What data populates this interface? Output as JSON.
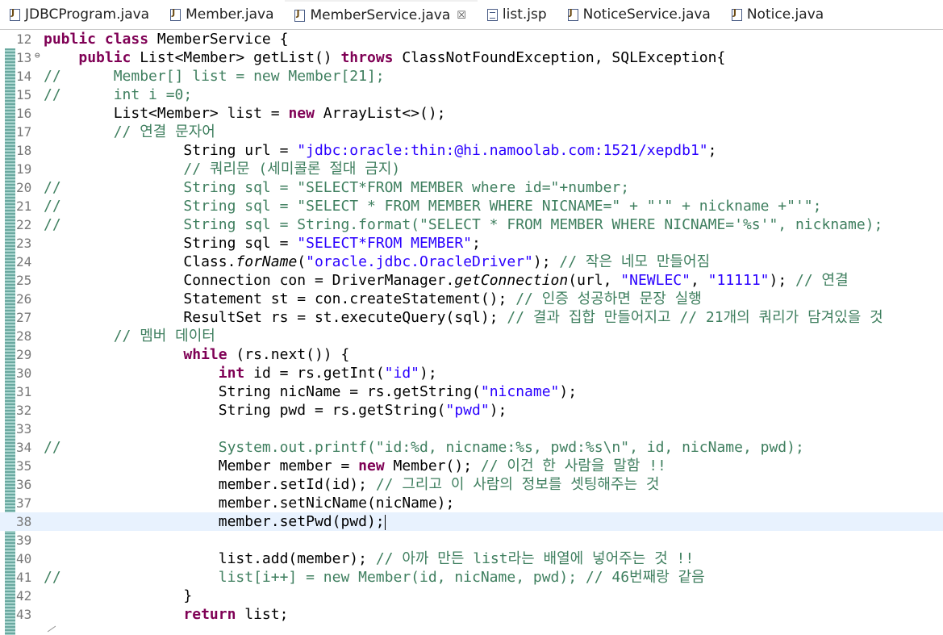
{
  "tabs": [
    {
      "label": "JDBCProgram.java",
      "icon": "java-file-icon",
      "active": false
    },
    {
      "label": "Member.java",
      "icon": "java-file-icon",
      "active": false
    },
    {
      "label": "MemberService.java",
      "icon": "java-file-icon",
      "active": true,
      "close": "☒"
    },
    {
      "label": "list.jsp",
      "icon": "jsp-file-icon",
      "active": false
    },
    {
      "label": "NoticeService.java",
      "icon": "java-file-icon",
      "active": false
    },
    {
      "label": "Notice.java",
      "icon": "java-file-icon",
      "active": false
    }
  ],
  "colors": {
    "keyword": "#7f0055",
    "string": "#2a00ff",
    "comment": "#3f7f5f",
    "line_number": "#787878",
    "current_line": "#e8f2fe"
  },
  "editor": {
    "current_line": 38,
    "lines": [
      {
        "n": "12",
        "segs": [
          [
            "kw",
            "public "
          ],
          [
            "kw",
            "class "
          ],
          [
            "",
            "MemberService {"
          ]
        ]
      },
      {
        "n": "13",
        "fold": "⊖",
        "segs": [
          [
            "",
            "    "
          ],
          [
            "kw",
            "public "
          ],
          [
            "",
            "List<Member> getList() "
          ],
          [
            "kw",
            "throws "
          ],
          [
            "",
            "ClassNotFoundException, SQLException{"
          ]
        ]
      },
      {
        "n": "14",
        "segs": [
          [
            "cm",
            "//      Member[] list = new Member[21];"
          ]
        ]
      },
      {
        "n": "15",
        "segs": [
          [
            "cm",
            "//      int i =0;"
          ]
        ]
      },
      {
        "n": "16",
        "segs": [
          [
            "",
            "        List<Member> list = "
          ],
          [
            "kw",
            "new "
          ],
          [
            "",
            "ArrayList<>();"
          ]
        ]
      },
      {
        "n": "17",
        "segs": [
          [
            "cm",
            "        // 연결 문자어"
          ]
        ]
      },
      {
        "n": "18",
        "segs": [
          [
            "",
            "                String url = "
          ],
          [
            "str",
            "\"jdbc:oracle:thin:@hi.namoolab.com:1521/xepdb1\""
          ],
          [
            "",
            ";"
          ]
        ]
      },
      {
        "n": "19",
        "segs": [
          [
            "cm",
            "                // 쿼리문 (세미콜론 절대 금지)"
          ]
        ]
      },
      {
        "n": "20",
        "segs": [
          [
            "cm",
            "//              String sql = \"SELECT*FROM MEMBER where id=\"+number;"
          ]
        ]
      },
      {
        "n": "21",
        "segs": [
          [
            "cm",
            "//              String sql = \"SELECT * FROM MEMBER WHERE NICNAME=\" + \"'\" + nickname +\"'\";"
          ]
        ]
      },
      {
        "n": "22",
        "segs": [
          [
            "cm",
            "//              String sql = String.format(\"SELECT * FROM MEMBER WHERE NICNAME='%s'\", nickname);"
          ]
        ]
      },
      {
        "n": "23",
        "segs": [
          [
            "",
            "                String sql = "
          ],
          [
            "str",
            "\"SELECT*FROM MEMBER\""
          ],
          [
            "",
            ";"
          ]
        ]
      },
      {
        "n": "24",
        "segs": [
          [
            "",
            "                Class."
          ],
          [
            "it",
            "forName"
          ],
          [
            "",
            "("
          ],
          [
            "str",
            "\"oracle.jdbc.OracleDriver\""
          ],
          [
            "",
            "); "
          ],
          [
            "cm",
            "// 작은 네모 만들어짐"
          ]
        ]
      },
      {
        "n": "25",
        "segs": [
          [
            "",
            "                Connection con = DriverManager."
          ],
          [
            "it",
            "getConnection"
          ],
          [
            "",
            "(url, "
          ],
          [
            "str",
            "\"NEWLEC\""
          ],
          [
            "",
            ", "
          ],
          [
            "str",
            "\"11111\""
          ],
          [
            "",
            "); "
          ],
          [
            "cm",
            "// 연결"
          ]
        ]
      },
      {
        "n": "26",
        "segs": [
          [
            "",
            "                Statement st = con.createStatement(); "
          ],
          [
            "cm",
            "// 인증 성공하면 문장 실행"
          ]
        ]
      },
      {
        "n": "27",
        "segs": [
          [
            "",
            "                ResultSet rs = st.executeQuery(sql); "
          ],
          [
            "cm",
            "// 결과 집합 만들어지고 // 21개의 쿼리가 담겨있을 것"
          ]
        ]
      },
      {
        "n": "28",
        "segs": [
          [
            "cm",
            "        // 멤버 데이터"
          ]
        ]
      },
      {
        "n": "29",
        "segs": [
          [
            "",
            "                "
          ],
          [
            "kw",
            "while "
          ],
          [
            "",
            "(rs.next()) {"
          ]
        ]
      },
      {
        "n": "30",
        "segs": [
          [
            "",
            "                    "
          ],
          [
            "kw",
            "int "
          ],
          [
            "",
            "id = rs.getInt("
          ],
          [
            "str",
            "\"id\""
          ],
          [
            "",
            ");"
          ]
        ]
      },
      {
        "n": "31",
        "segs": [
          [
            "",
            "                    String nicName = rs.getString("
          ],
          [
            "str",
            "\"nicname\""
          ],
          [
            "",
            ");"
          ]
        ]
      },
      {
        "n": "32",
        "segs": [
          [
            "",
            "                    String pwd = rs.getString("
          ],
          [
            "str",
            "\"pwd\""
          ],
          [
            "",
            ");"
          ]
        ]
      },
      {
        "n": "33",
        "segs": []
      },
      {
        "n": "34",
        "segs": [
          [
            "cm",
            "//                  System.out.printf(\"id:%d, nicname:%s, pwd:%s\\n\", id, nicName, pwd);"
          ]
        ]
      },
      {
        "n": "35",
        "segs": [
          [
            "",
            "                    Member member = "
          ],
          [
            "kw",
            "new "
          ],
          [
            "",
            "Member(); "
          ],
          [
            "cm",
            "// 이건 한 사람을 말함 !!"
          ]
        ]
      },
      {
        "n": "36",
        "segs": [
          [
            "",
            "                    member.setId(id); "
          ],
          [
            "cm",
            "// 그리고 이 사람의 정보를 셋팅해주는 것"
          ]
        ]
      },
      {
        "n": "37",
        "segs": [
          [
            "",
            "                    member.setNicName(nicName);"
          ]
        ]
      },
      {
        "n": "38",
        "segs": [
          [
            "",
            "                    member.setPwd(pwd);"
          ]
        ],
        "caret": true
      },
      {
        "n": "39",
        "segs": []
      },
      {
        "n": "40",
        "segs": [
          [
            "",
            "                    list.add(member); "
          ],
          [
            "cm",
            "// 아까 만든 list라는 배열에 넣어주는 것 !!"
          ]
        ]
      },
      {
        "n": "41",
        "segs": [
          [
            "cm",
            "//                  list[i++] = new Member(id, nicName, pwd); // 46번째랑 같음"
          ]
        ]
      },
      {
        "n": "42",
        "segs": [
          [
            "",
            "                }"
          ]
        ]
      },
      {
        "n": "43",
        "segs": [
          [
            "",
            "                "
          ],
          [
            "kw",
            "return "
          ],
          [
            "",
            "list;"
          ]
        ]
      }
    ]
  }
}
